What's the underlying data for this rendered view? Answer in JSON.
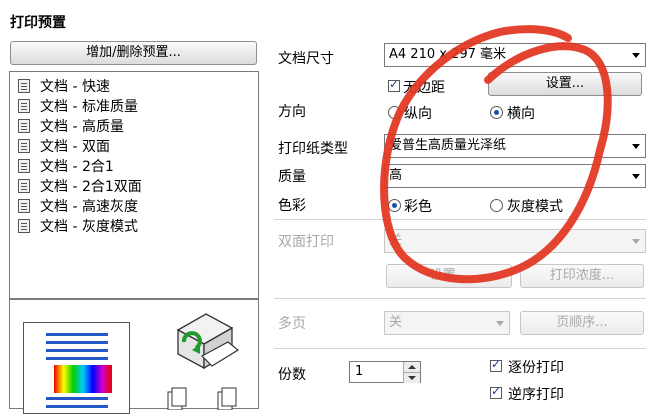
{
  "preset": {
    "title": "打印预置",
    "add_delete_button": "增加/删除预置...",
    "items": [
      {
        "label": "文档 - 快速",
        "icon": "doc-fast-icon"
      },
      {
        "label": "文档 - 标准质量",
        "icon": "doc-standard-icon"
      },
      {
        "label": "文档 - 高质量",
        "icon": "doc-high-quality-icon"
      },
      {
        "label": "文档 - 双面",
        "icon": "doc-duplex-icon"
      },
      {
        "label": "文档 - 2合1",
        "icon": "doc-2up-icon"
      },
      {
        "label": "文档 - 2合1双面",
        "icon": "doc-2up-duplex-icon"
      },
      {
        "label": "文档 - 高速灰度",
        "icon": "doc-fast-grayscale-icon"
      },
      {
        "label": "文档 - 灰度模式",
        "icon": "doc-grayscale-icon"
      }
    ]
  },
  "settings": {
    "doc_size": {
      "label": "文档尺寸",
      "value": "A4 210 x 297 毫米"
    },
    "borderless": {
      "label": "无边距",
      "checked": true
    },
    "settings_button": "设置...",
    "orientation": {
      "label": "方向",
      "portrait": "纵向",
      "landscape": "横向",
      "selected": "横向"
    },
    "paper_type": {
      "label": "打印纸类型",
      "value": "爱普生高质量光泽纸"
    },
    "quality": {
      "label": "质量",
      "value": "高"
    },
    "color": {
      "label": "色彩",
      "color_option": "彩色",
      "gray_option": "灰度模式",
      "selected": "彩色"
    },
    "duplex": {
      "label": "双面打印",
      "value": "关",
      "settings_button": "设置...",
      "density_button": "打印浓度..."
    },
    "multipage": {
      "label": "多页",
      "value": "关",
      "page_order_button": "页顺序..."
    },
    "copies": {
      "label": "份数",
      "value": "1"
    },
    "collate": {
      "label": "逐份打印",
      "checked": true
    },
    "reverse_order": {
      "label": "逆序打印",
      "checked": true
    }
  },
  "colors": {
    "annotation": "#e2331e",
    "selection_blue": "#1a4fb0"
  }
}
